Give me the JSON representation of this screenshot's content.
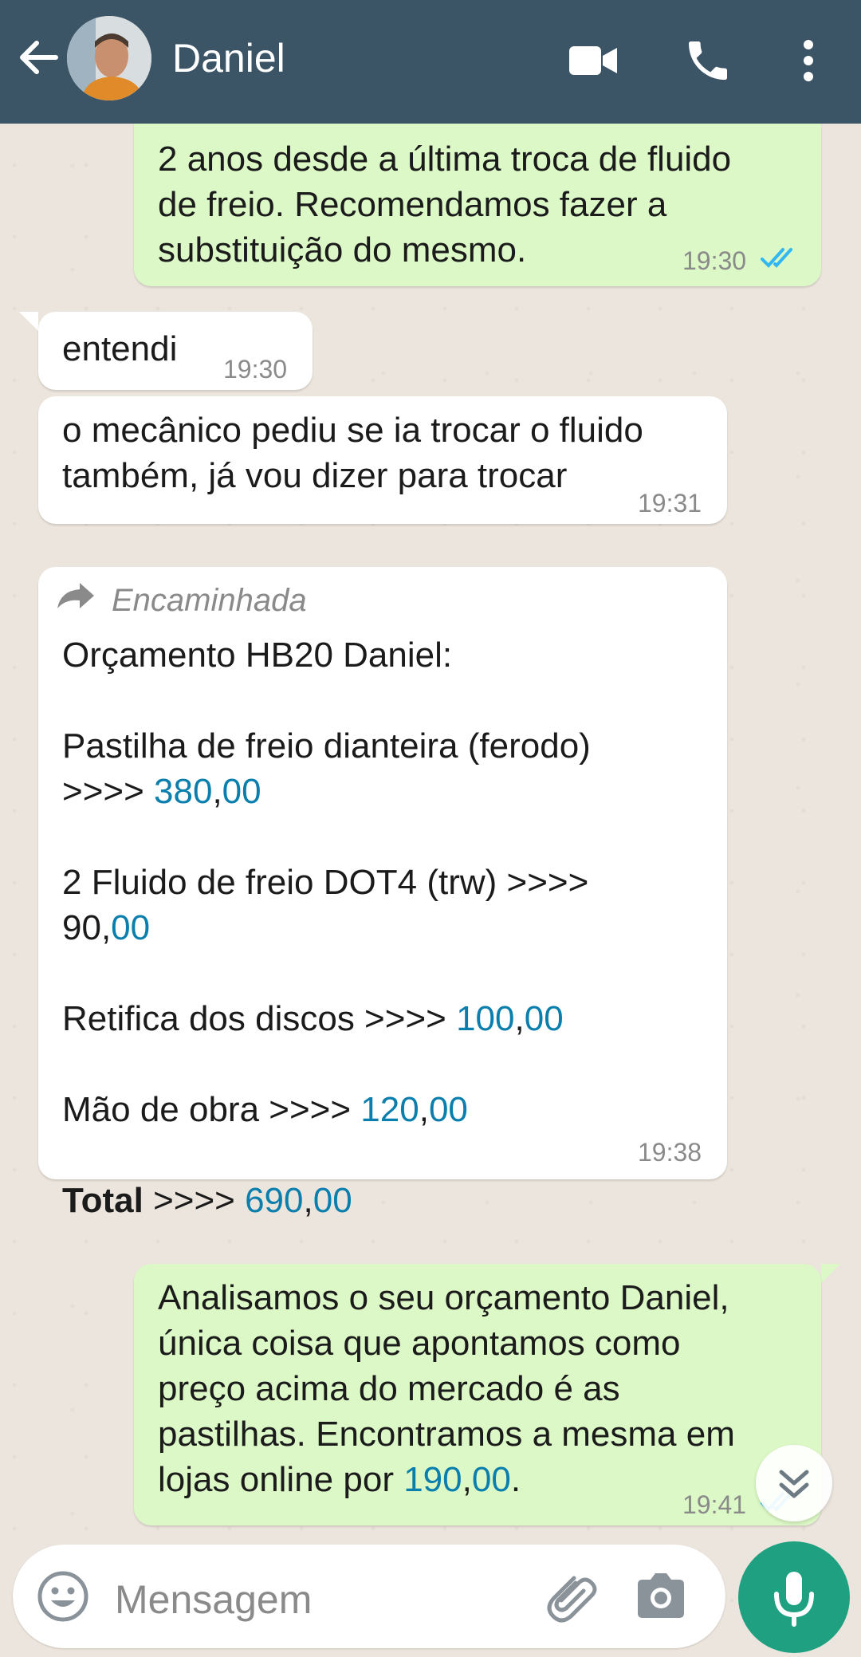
{
  "header": {
    "contact_name": "Daniel"
  },
  "messages": {
    "m1": {
      "lines": [
        "2 anos desde a última troca de fluido",
        "de freio. Recomendamos fazer a",
        "substituição do mesmo."
      ],
      "time": "19:30"
    },
    "m2": {
      "text": "entendi",
      "time": "19:30"
    },
    "m3": {
      "lines": [
        "o mecânico pediu se ia trocar o fluido",
        "também, já vou dizer para trocar"
      ],
      "time": "19:31"
    },
    "m4": {
      "forwarded_label": "Encaminhada",
      "title": "Orçamento HB20 Daniel:",
      "item1_line1": "Pastilha de freio dianteira (ferodo)",
      "item1_prefix": ">>>> ",
      "item1_int": "380",
      "item1_comma": ",",
      "item1_dec": "00",
      "item2_line1": "2 Fluido de freio DOT4 (trw) >>>>",
      "item2_int": "90,",
      "item2_dec": "00",
      "item3_prefix": "Retifica dos discos >>>> ",
      "item3_int": "100",
      "item3_comma": ",",
      "item3_dec": "00",
      "item4_prefix": "Mão de obra >>>> ",
      "item4_int": "120",
      "item4_comma": ",",
      "item4_dec": "00",
      "total_label": "Total",
      "total_prefix": " >>>> ",
      "total_int": "690",
      "total_comma": ",",
      "total_dec": "00",
      "time": "19:38"
    },
    "m5": {
      "lines": [
        "Analisamos o seu orçamento Daniel,",
        "única coisa que apontamos como",
        "preço acima do mercado é as",
        "pastilhas. Encontramos a mesma em"
      ],
      "last_prefix": "lojas online por ",
      "last_int": "190",
      "last_comma": ",",
      "last_dec": "00",
      "last_suffix": ".",
      "time": "19:41"
    }
  },
  "composer": {
    "placeholder": "Mensagem"
  },
  "colors": {
    "header": "#3b5566",
    "outgoing_bubble": "#dcf8c6",
    "incoming_bubble": "#ffffff",
    "link": "#0a7eac",
    "read_ticks": "#34b7f1",
    "mic_button": "#1fa181"
  },
  "icons": [
    "back-arrow-icon",
    "video-call-icon",
    "phone-icon",
    "more-vert-icon",
    "forward-icon",
    "double-check-icon",
    "chevron-double-down-icon",
    "emoji-icon",
    "attach-icon",
    "camera-icon",
    "mic-icon"
  ]
}
